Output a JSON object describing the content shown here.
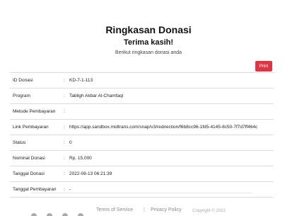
{
  "header": {
    "title": "Ringkasan Donasi",
    "subtitle": "Terima kasih!",
    "description": "Berikut ringkasan donasi anda"
  },
  "actions": {
    "print_label": "Print"
  },
  "summary": {
    "separator": ":",
    "rows": [
      {
        "label": "ID Donasi",
        "value": "KD-7-1-113"
      },
      {
        "label": "Program",
        "value": "Tabligh Akbar Al-Chamfaqi"
      },
      {
        "label": "Metode Pembayaran",
        "value": ""
      },
      {
        "label": "Link Pembayaran",
        "value": "https://app.sandbox.midtrans.com/snap/v3/redirection/f6b8cc96-1fd5-4145-8c50-7f7d7ff464c"
      },
      {
        "label": "Status",
        "value": "0"
      },
      {
        "label": "Nominal Donasi",
        "value": "Rp. 15,000"
      },
      {
        "label": "Tanggal Donasi",
        "value": "2022-08-13 06:21:39"
      },
      {
        "label": "Tanggal Pembayaran",
        "value": "-"
      }
    ]
  },
  "footer": {
    "terms_label": "Terms of Service",
    "divider": "|",
    "privacy_label": "Privacy Policy",
    "copyright": "Copyright © 2022"
  }
}
